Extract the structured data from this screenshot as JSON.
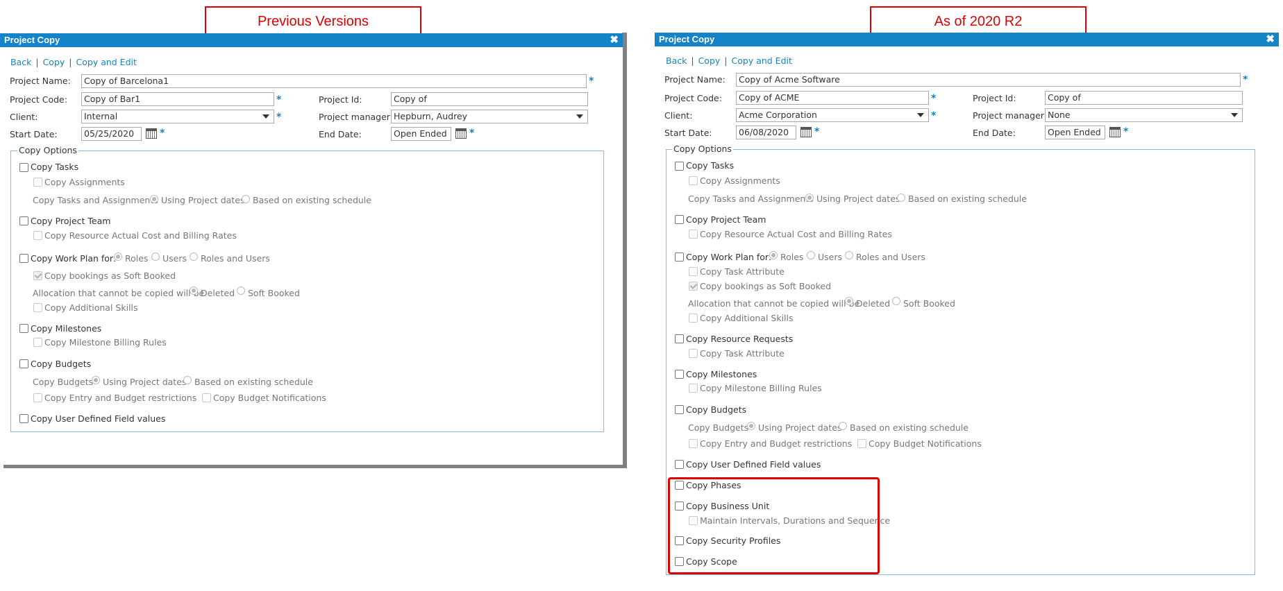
{
  "callouts": {
    "left": "Previous Versions",
    "right": "As of 2020 R2"
  },
  "left": {
    "title": "Project Copy",
    "close": "✖",
    "links": {
      "back": "Back",
      "copy": "Copy",
      "copy_edit": "Copy and Edit",
      "sep": "|"
    },
    "fields": {
      "project_name_label": "Project Name:",
      "project_name": "Copy of Barcelona1",
      "project_code_label": "Project Code:",
      "project_code": "Copy of Bar1",
      "project_id_label": "Project Id:",
      "project_id": "Copy of",
      "client_label": "Client:",
      "client": "Internal",
      "manager_label": "Project manager:",
      "manager": "Hepburn, Audrey",
      "start_label": "Start Date:",
      "start": "05/25/2020",
      "end_label": "End Date:",
      "end": "Open Ended",
      "req": "*"
    },
    "opts": {
      "legend": "Copy Options",
      "copy_tasks": "Copy Tasks",
      "copy_assignments": "Copy Assignments",
      "tasks_assign_label": "Copy Tasks and Assignments",
      "using_project_dates": "Using Project dates",
      "based_existing": "Based on existing schedule",
      "copy_project_team": "Copy Project Team",
      "copy_resource_rates": "Copy Resource Actual Cost and Billing Rates",
      "copy_work_plan": "Copy Work Plan for:",
      "roles": "Roles",
      "users": "Users",
      "roles_users": "Roles and Users",
      "copy_bookings_soft": "Copy bookings as Soft Booked",
      "alloc_label": "Allocation that cannot be copied will be",
      "deleted": "Deleted",
      "soft_booked": "Soft Booked",
      "copy_additional_skills": "Copy Additional Skills",
      "copy_milestones": "Copy Milestones",
      "copy_milestone_billing": "Copy Milestone Billing Rules",
      "copy_budgets": "Copy Budgets",
      "budgets_label": "Copy Budgets",
      "budget_using_project_dates": "Using Project dates",
      "budget_based_existing": "Based on existing schedule",
      "copy_entry_budget": "Copy Entry and Budget restrictions",
      "copy_budget_notif": "Copy Budget Notifications",
      "copy_udf": "Copy User Defined Field values"
    }
  },
  "right": {
    "title": "Project Copy",
    "close": "✖",
    "links": {
      "back": "Back",
      "copy": "Copy",
      "copy_edit": "Copy and Edit",
      "sep": "|"
    },
    "fields": {
      "project_name_label": "Project Name:",
      "project_name": "Copy of Acme Software",
      "project_code_label": "Project Code:",
      "project_code": "Copy of ACME",
      "project_id_label": "Project Id:",
      "project_id": "Copy of",
      "client_label": "Client:",
      "client": "Acme Corporation",
      "manager_label": "Project manager:",
      "manager": "None",
      "start_label": "Start Date:",
      "start": "06/08/2020",
      "end_label": "End Date:",
      "end": "Open Ended",
      "req": "*"
    },
    "opts": {
      "legend": "Copy Options",
      "copy_tasks": "Copy Tasks",
      "copy_assignments": "Copy Assignments",
      "tasks_assign_label": "Copy Tasks and Assignments",
      "using_project_dates": "Using Project dates",
      "based_existing": "Based on existing schedule",
      "copy_project_team": "Copy Project Team",
      "copy_resource_rates": "Copy Resource Actual Cost and Billing Rates",
      "copy_work_plan": "Copy Work Plan for:",
      "roles": "Roles",
      "users": "Users",
      "roles_users": "Roles and Users",
      "copy_task_attribute": "Copy Task Attribute",
      "copy_bookings_soft": "Copy bookings as Soft Booked",
      "alloc_label": "Allocation that cannot be copied will be",
      "deleted": "Deleted",
      "soft_booked": "Soft Booked",
      "copy_additional_skills": "Copy Additional Skills",
      "copy_resource_requests": "Copy Resource Requests",
      "copy_task_attribute_2": "Copy Task Attribute",
      "copy_milestones": "Copy Milestones",
      "copy_milestone_billing": "Copy Milestone Billing Rules",
      "copy_budgets": "Copy Budgets",
      "budgets_label": "Copy Budgets",
      "budget_using_project_dates": "Using Project dates",
      "budget_based_existing": "Based on existing schedule",
      "copy_entry_budget": "Copy Entry and Budget restrictions",
      "copy_budget_notif": "Copy Budget Notifications",
      "copy_udf": "Copy User Defined Field values",
      "copy_phases": "Copy Phases",
      "copy_business_unit": "Copy Business Unit",
      "maintain_intervals": "Maintain Intervals, Durations and Sequence",
      "copy_security_profiles": "Copy Security Profiles",
      "copy_scope": "Copy Scope"
    }
  }
}
